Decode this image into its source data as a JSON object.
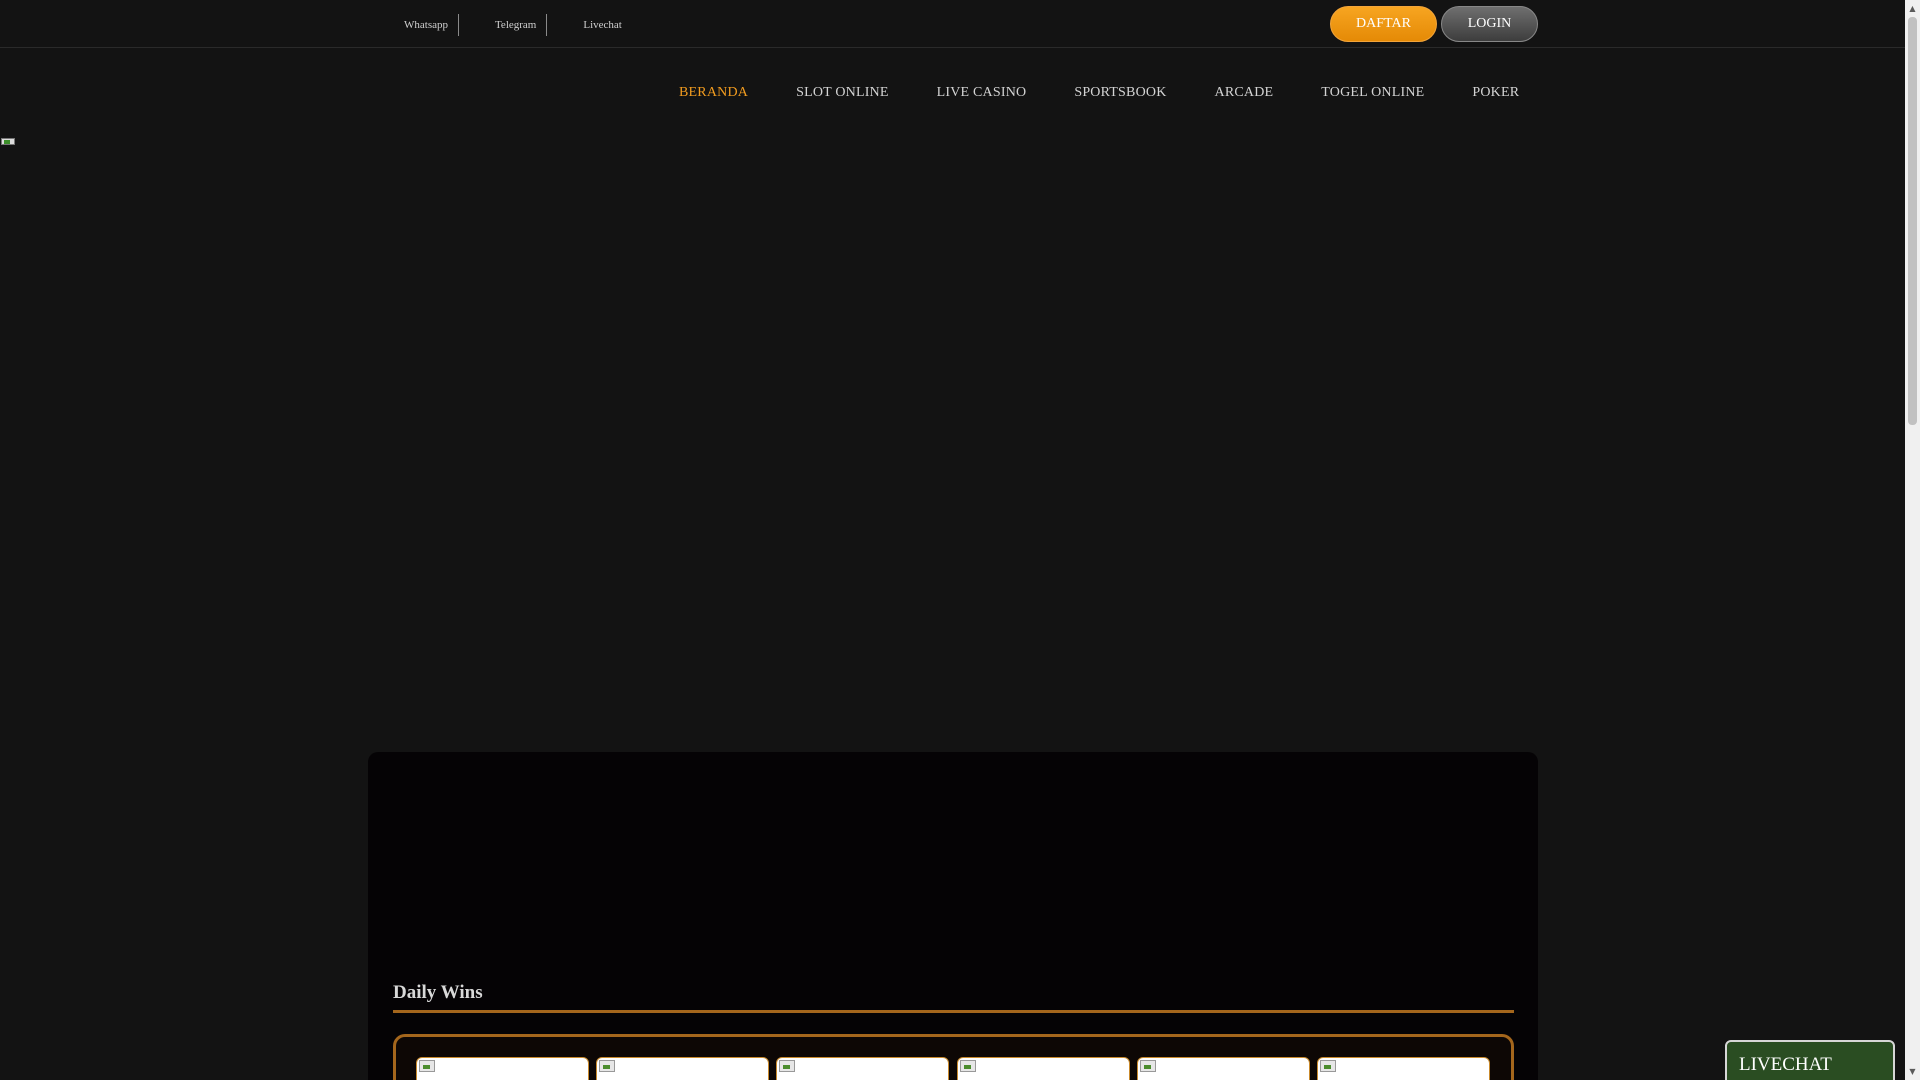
{
  "topbar": {
    "contacts": [
      {
        "label": "Whatsapp",
        "icon": "whatsapp-icon"
      },
      {
        "label": "Telegram",
        "icon": "telegram-icon"
      },
      {
        "label": "Livechat",
        "icon": "livechat-icon"
      }
    ],
    "daftar_label": "DAFTAR",
    "login_label": "LOGIN"
  },
  "nav": {
    "items": [
      {
        "label": "BERANDA",
        "active": true
      },
      {
        "label": "SLOT ONLINE",
        "active": false
      },
      {
        "label": "LIVE CASINO",
        "active": false
      },
      {
        "label": "SPORTSBOOK",
        "active": false
      },
      {
        "label": "ARCADE",
        "active": false
      },
      {
        "label": "TOGEL ONLINE",
        "active": false
      },
      {
        "label": "POKER",
        "active": false
      }
    ]
  },
  "main": {
    "section_title": "Daily Wins",
    "win_cards_count": 6
  },
  "livechat_widget": {
    "label": "LIVECHAT"
  },
  "colors": {
    "accent": "#f29c1f",
    "background": "#131313",
    "panel": "#050305",
    "border_gold": "#a4661c",
    "daftar_button": "#f7a521",
    "login_button": "#5a5a5a",
    "livechat_widget": "#2a4d22"
  }
}
